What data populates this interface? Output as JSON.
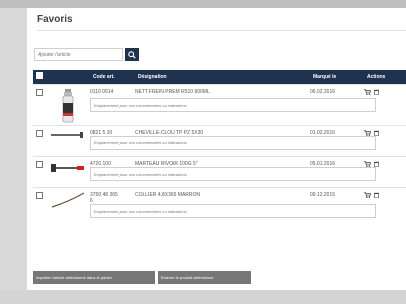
{
  "page": {
    "title": "Favoris"
  },
  "search": {
    "placeholder": "Ajouter l'article"
  },
  "table": {
    "columns": {
      "code": "Code art.",
      "designation": "Désignation",
      "marked": "Marqué le",
      "actions": "Actions"
    },
    "rows": [
      {
        "code": "0110 0914",
        "designation": "NETT.FREIN PREM R510 600ML",
        "date": "06.02.2016",
        "comment_placeholder": "Emplacement pour vos commentaires ou indications",
        "thumbnail": "spray-can"
      },
      {
        "code": "0821 5 30",
        "designation": "CHEVILLE-CLOU TP PZ 5X30",
        "date": "01.02.2016",
        "comment_placeholder": "Emplacement pour vos commentaires ou indications",
        "thumbnail": "nail-anchor"
      },
      {
        "code": "4720 100",
        "designation": "MARTEAU RIVOIR 100G 5\"",
        "date": "05.01.2016",
        "comment_placeholder": "Emplacement pour vos commentaires ou indications",
        "thumbnail": "hammer"
      },
      {
        "code_line1": "3750 48 365",
        "code_line2": "6",
        "designation": "COLLIER 4,8X365 MARRON",
        "date": "09.12.2015",
        "comment_placeholder": "Emplacement pour vos commentaires ou indications",
        "thumbnail": "cable-tie"
      }
    ]
  },
  "buttons": {
    "import_cart": "Importer l'article sélectionné dans le panier",
    "remove_selected": "Enlever le produit sélectionné"
  },
  "colors": {
    "header_bg": "#1f3250",
    "button_bg": "#777777",
    "search_button": "#1e3350"
  },
  "icons": {
    "search": "search-icon",
    "cart": "cart-icon",
    "delete": "trash-icon"
  }
}
